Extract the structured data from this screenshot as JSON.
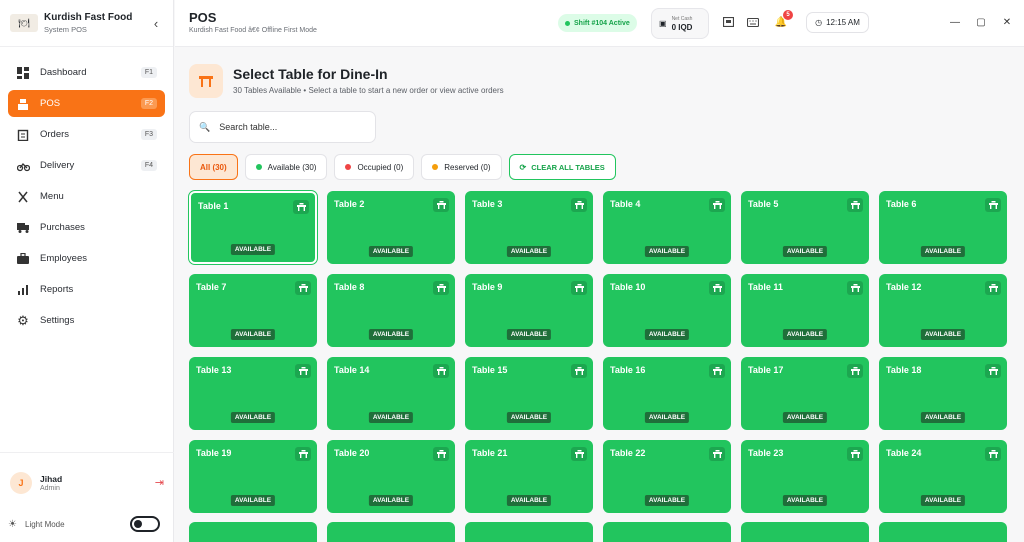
{
  "app": {
    "name": "Kurdish Fast Food",
    "subtitle": "System POS",
    "logo_icon": "restaurant-logo"
  },
  "sidebar": {
    "items": [
      {
        "label": "Dashboard",
        "key": "F1",
        "icon": "grid-icon"
      },
      {
        "label": "POS",
        "key": "F2",
        "icon": "register-icon",
        "active": true
      },
      {
        "label": "Orders",
        "key": "F3",
        "icon": "clipboard-icon"
      },
      {
        "label": "Delivery",
        "key": "F4",
        "icon": "bike-icon"
      },
      {
        "label": "Menu",
        "icon": "utensils-icon"
      },
      {
        "label": "Purchases",
        "icon": "truck-icon"
      },
      {
        "label": "Employees",
        "icon": "briefcase-icon"
      },
      {
        "label": "Reports",
        "icon": "chart-icon"
      },
      {
        "label": "Settings",
        "icon": "gear-icon"
      }
    ],
    "user": {
      "initial": "J",
      "name": "Jihad",
      "role": "Admin"
    },
    "theme_label": "Light Mode"
  },
  "header": {
    "title": "POS",
    "subtitle": "Kurdish Fast Food â€¢ Offline First Mode",
    "shift": "Shift #104 Active",
    "cash_label": "Net Cash",
    "cash_value": "0 IQD",
    "notification_count": "5",
    "time": "12:15 AM"
  },
  "main": {
    "title": "Select Table for Dine-In",
    "subtitle": "30 Tables Available • Select a table to start a new order or view active orders",
    "search_placeholder": "Search table...",
    "filters": [
      {
        "label": "All (30)",
        "active": true
      },
      {
        "label": "Available (30)",
        "color": "#22c55e"
      },
      {
        "label": "Occupied (0)",
        "color": "#ef4444"
      },
      {
        "label": "Reserved (0)",
        "color": "#f59e0b"
      }
    ],
    "clear_label": "CLEAR ALL TABLES",
    "tables": [
      {
        "name": "Table 1",
        "status": "AVAILABLE"
      },
      {
        "name": "Table 2",
        "status": "AVAILABLE"
      },
      {
        "name": "Table 3",
        "status": "AVAILABLE"
      },
      {
        "name": "Table 4",
        "status": "AVAILABLE"
      },
      {
        "name": "Table 5",
        "status": "AVAILABLE"
      },
      {
        "name": "Table 6",
        "status": "AVAILABLE"
      },
      {
        "name": "Table 7",
        "status": "AVAILABLE"
      },
      {
        "name": "Table 8",
        "status": "AVAILABLE"
      },
      {
        "name": "Table 9",
        "status": "AVAILABLE"
      },
      {
        "name": "Table 10",
        "status": "AVAILABLE"
      },
      {
        "name": "Table 11",
        "status": "AVAILABLE"
      },
      {
        "name": "Table 12",
        "status": "AVAILABLE"
      },
      {
        "name": "Table 13",
        "status": "AVAILABLE"
      },
      {
        "name": "Table 14",
        "status": "AVAILABLE"
      },
      {
        "name": "Table 15",
        "status": "AVAILABLE"
      },
      {
        "name": "Table 16",
        "status": "AVAILABLE"
      },
      {
        "name": "Table 17",
        "status": "AVAILABLE"
      },
      {
        "name": "Table 18",
        "status": "AVAILABLE"
      },
      {
        "name": "Table 19",
        "status": "AVAILABLE"
      },
      {
        "name": "Table 20",
        "status": "AVAILABLE"
      },
      {
        "name": "Table 21",
        "status": "AVAILABLE"
      },
      {
        "name": "Table 22",
        "status": "AVAILABLE"
      },
      {
        "name": "Table 23",
        "status": "AVAILABLE"
      },
      {
        "name": "Table 24",
        "status": "AVAILABLE"
      }
    ]
  },
  "colors": {
    "accent": "#f97316",
    "available": "#22c55e",
    "occupied": "#ef4444",
    "reserved": "#f59e0b"
  }
}
